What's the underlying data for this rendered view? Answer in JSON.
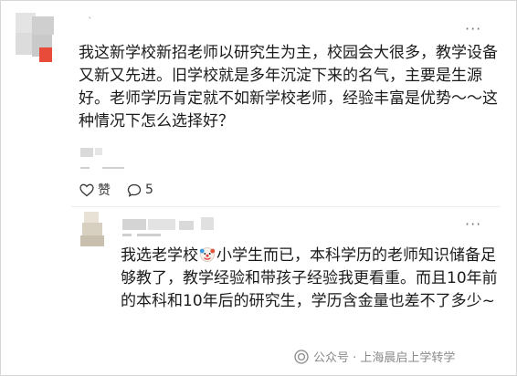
{
  "post": {
    "more_icon": "more-horizontal-icon",
    "text": "我这新学校新招老师以研究生为主，校园会大很多，教学设备又新又先进。旧学校就是多年沉淀下来的名气，主要是生源好。老师学历肯定就不如新学校老师，经验丰富是优势～～这种情况下怎么选择好？",
    "like_label": "赞",
    "comment_count": "5",
    "like_icon": "heart-outline-icon",
    "comment_icon": "comment-bubble-icon"
  },
  "reply": {
    "more_icon": "more-horizontal-icon",
    "text_before_emoji": "我选老学校",
    "emoji": "clown-face-emoji",
    "text_after_emoji": "小学生而已，本科学历的老师知识储备足够教了，教学经验和带孩子经验我更看重。而且10年前的本科和10年后的研究生，学历含金量也差不了多少~"
  },
  "watermark": {
    "text": "公众号 · 上海晨启上学转学",
    "icon": "wechat-official-account-icon"
  },
  "colors": {
    "text": "#1a1a1a",
    "muted": "#8a8a8a",
    "avatar_accent": "#e84b3a"
  }
}
